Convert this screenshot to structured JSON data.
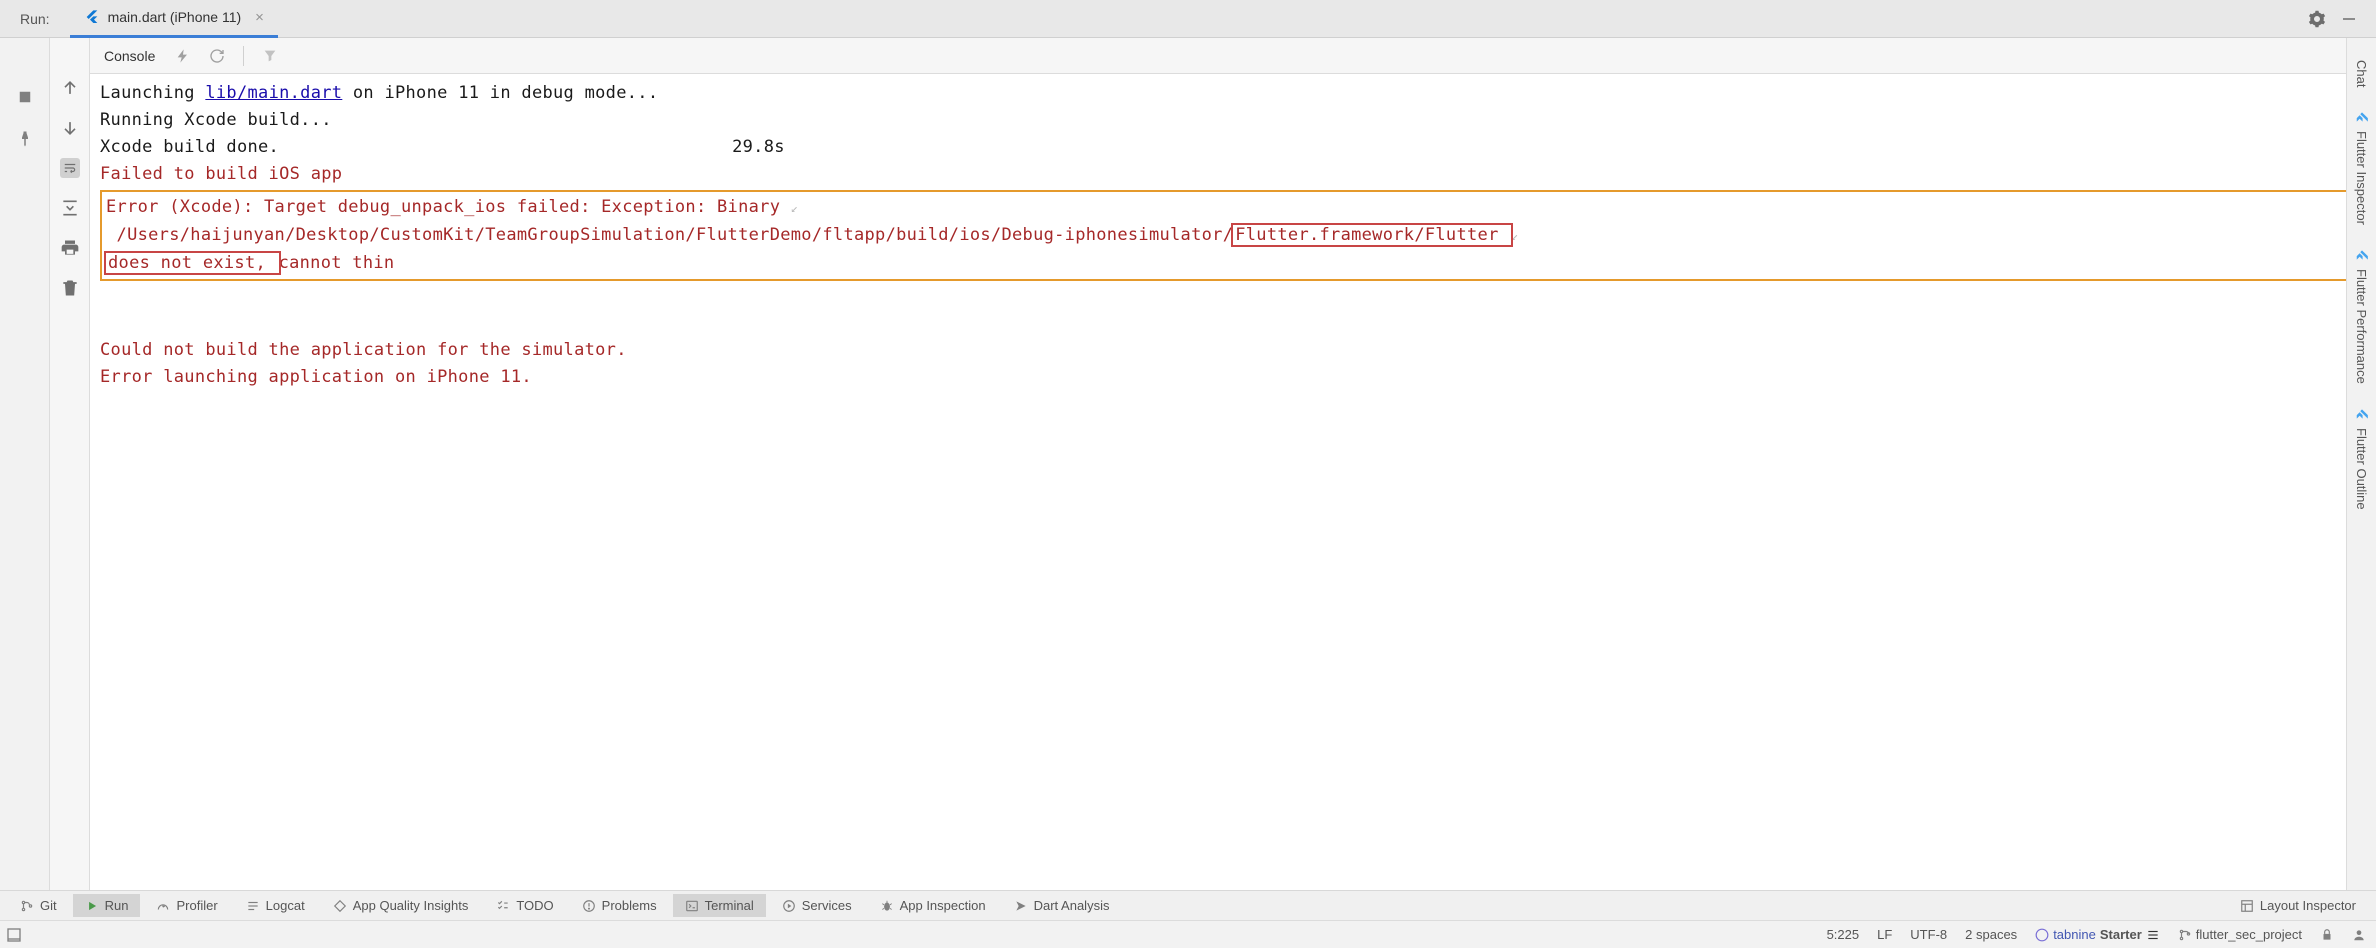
{
  "topBar": {
    "runLabel": "Run:",
    "tabLabel": "main.dart (iPhone 11)"
  },
  "console": {
    "title": "Console",
    "lines": {
      "launching_pre": "Launching ",
      "launching_link": "lib/main.dart",
      "launching_post": " on iPhone 11 in debug mode...",
      "running": "Running Xcode build...",
      "build_done": "Xcode build done.                                           29.8s",
      "failed": "Failed to build iOS app",
      "error1": "Error (Xcode): Target debug_unpack_ios failed: Exception: Binary ",
      "error2_a": " /Users/haijunyan/Desktop/CustomKit/TeamGroupSimulation/FlutterDemo/fltapp/build/ios/Debug-iphonesimulator/",
      "error2_b": "Flutter.framework/Flutter ",
      "error3_a": "does not exist, ",
      "error3_b": "cannot thin",
      "couldnot": "Could not build the application for the simulator.",
      "errlaunch": "Error launching application on iPhone 11."
    }
  },
  "rightSidebar": {
    "chat": "Chat",
    "inspector": "Flutter Inspector",
    "performance": "Flutter Performance",
    "outline": "Flutter Outline"
  },
  "bottomBar": {
    "git": "Git",
    "run": "Run",
    "profiler": "Profiler",
    "logcat": "Logcat",
    "appquality": "App Quality Insights",
    "todo": "TODO",
    "problems": "Problems",
    "terminal": "Terminal",
    "services": "Services",
    "appinspection": "App Inspection",
    "dartanalysis": "Dart Analysis",
    "layoutinspector": "Layout Inspector"
  },
  "statusBar": {
    "pos": "5:225",
    "lf": "LF",
    "enc": "UTF-8",
    "spaces": "2 spaces",
    "tabnine": "tabnine",
    "starter": "Starter",
    "branch": "flutter_sec_project"
  }
}
